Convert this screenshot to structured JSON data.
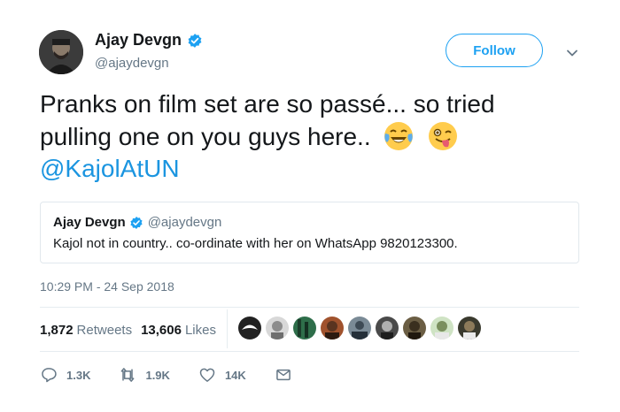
{
  "author": {
    "name": "Ajay Devgn",
    "handle": "@ajaydevgn",
    "avatar_icon": "avatar-photo"
  },
  "follow_label": "Follow",
  "tweet": {
    "text_line1": "Pranks on film set are so passé... so tried",
    "text_line2": "pulling one on you guys here..",
    "emojis": [
      "face-with-tears-of-joy",
      "winking-face-with-tongue"
    ],
    "mention": "@KajolAtUN"
  },
  "quoted": {
    "name": "Ajay Devgn",
    "handle": "@ajaydevgn",
    "text": "Kajol not in country.. co-ordinate with her on WhatsApp 9820123300."
  },
  "timestamp": "10:29 PM - 24 Sep 2018",
  "stats": {
    "retweets_count": "1,872",
    "retweets_label": "Retweets",
    "likes_count": "13,606",
    "likes_label": "Likes"
  },
  "liker_count": 9,
  "actions": {
    "replies": "1.3K",
    "retweets": "1.9K",
    "likes": "14K"
  },
  "colors": {
    "accent": "#1da1f2",
    "link": "#1b95e0",
    "muted": "#657786"
  }
}
